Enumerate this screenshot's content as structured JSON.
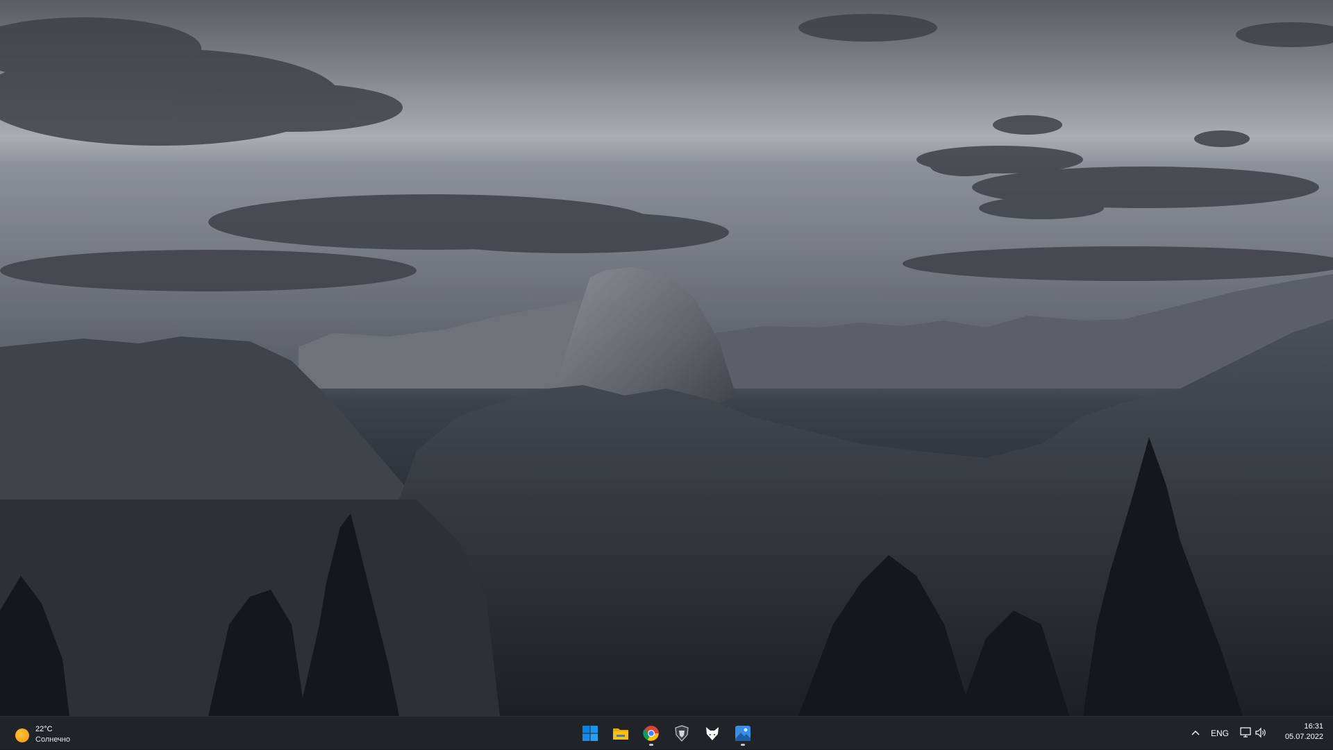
{
  "desktop": {
    "wallpaper": "mountain-dusk-wallpaper"
  },
  "taskbar": {
    "weather": {
      "temperature": "22°C",
      "condition": "Солнечно",
      "icon": "sun-icon"
    },
    "pinned": [
      {
        "name": "start-button",
        "icon": "windows-logo-icon",
        "running": false
      },
      {
        "name": "file-explorer-button",
        "icon": "folder-icon",
        "running": false
      },
      {
        "name": "chrome-button",
        "icon": "chrome-icon",
        "running": true
      },
      {
        "name": "world-of-tanks-button",
        "icon": "shield-icon",
        "running": false
      },
      {
        "name": "fox-app-button",
        "icon": "fox-icon",
        "running": false
      },
      {
        "name": "photos-button",
        "icon": "photos-icon",
        "running": true
      }
    ],
    "tray": {
      "language": "ENG",
      "time": "16:31",
      "date": "05.07.2022"
    }
  },
  "colors": {
    "taskbar_bg": "#202328",
    "accent_blue": "#0a84e0",
    "folder_yellow": "#f4c01e"
  }
}
